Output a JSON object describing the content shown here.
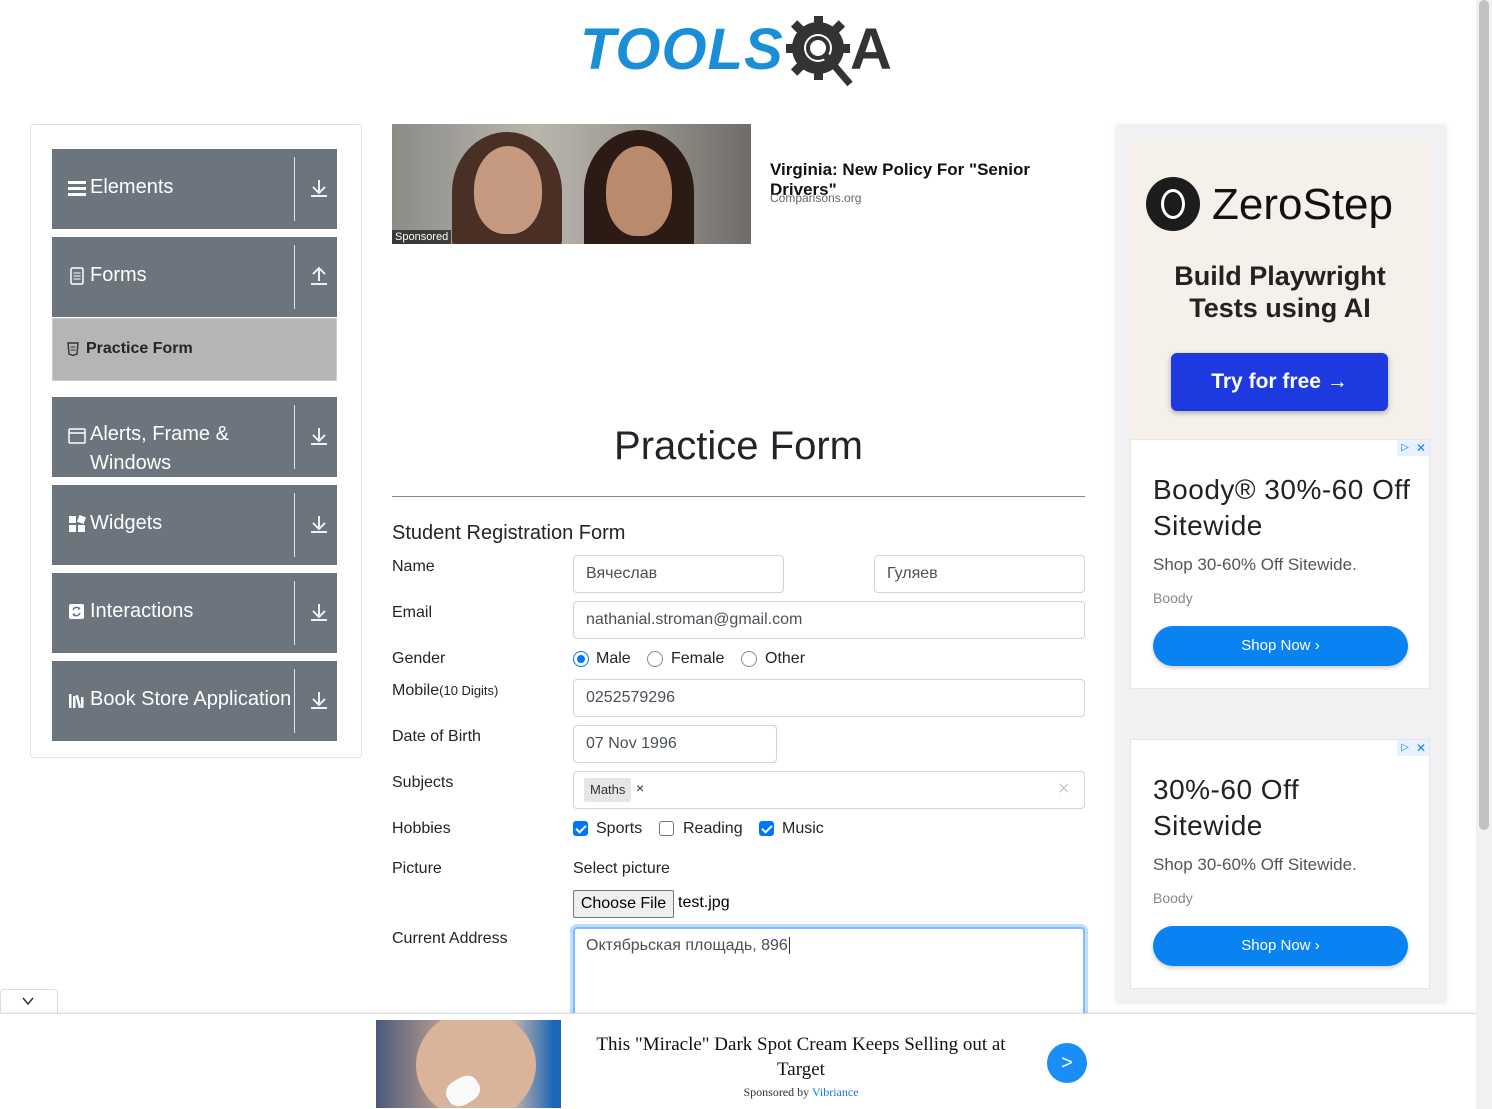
{
  "logo": {
    "text": "TOOLS",
    "suffix": "A"
  },
  "sidebar": {
    "groups": [
      {
        "label": "Elements",
        "icon": "hamburger-icon",
        "expanded": false
      },
      {
        "label": "Forms",
        "icon": "document-icon",
        "expanded": true
      },
      {
        "label": "Alerts, Frame & Windows",
        "icon": "window-icon",
        "expanded": false
      },
      {
        "label": "Widgets",
        "icon": "widgets-icon",
        "expanded": false
      },
      {
        "label": "Interactions",
        "icon": "refresh-icon",
        "expanded": false
      },
      {
        "label": "Book Store Application",
        "icon": "books-icon",
        "expanded": false
      }
    ],
    "forms_items": [
      {
        "label": "Practice Form",
        "active": true
      }
    ]
  },
  "ad_top": {
    "headline": "Virginia: New Policy For \"Senior Drivers\"",
    "source": "Comparisons.org",
    "sponsored": "Sponsored"
  },
  "page": {
    "title": "Practice Form",
    "form_title": "Student Registration Form"
  },
  "form": {
    "name_label": "Name",
    "first_name": "Вячеслав",
    "last_name": "Гуляев",
    "email_label": "Email",
    "email": "nathanial.stroman@gmail.com",
    "gender_label": "Gender",
    "gender_options": [
      "Male",
      "Female",
      "Other"
    ],
    "gender_selected": "Male",
    "mobile_label": "Mobile",
    "mobile_hint": "(10 Digits)",
    "mobile": "0252579296",
    "dob_label": "Date of Birth",
    "dob": "07 Nov 1996",
    "subjects_label": "Subjects",
    "subjects": [
      "Maths"
    ],
    "subject_remove": "×",
    "subjects_clear": "×",
    "hobbies_label": "Hobbies",
    "hobbies": [
      {
        "label": "Sports",
        "checked": true
      },
      {
        "label": "Reading",
        "checked": false
      },
      {
        "label": "Music",
        "checked": true
      }
    ],
    "picture_label": "Picture",
    "picture_prompt": "Select picture",
    "file_button": "Choose File",
    "file_name": "test.jpg",
    "address_label": "Current Address",
    "address": "Октябрьская площадь, 896"
  },
  "ad_zerostep": {
    "brand": "ZeroStep",
    "tagline_1": "Build Playwright",
    "tagline_2": "Tests using AI",
    "button": "Try for free →"
  },
  "ad_boody_1": {
    "headline": "Boody® 30%-60 Off Sitewide",
    "sub": "Shop 30-60% Off Sitewide.",
    "brand": "Boody",
    "button": "Shop Now"
  },
  "ad_boody_2": {
    "headline": "30%-60 Off Sitewide",
    "sub": "Shop 30-60% Off Sitewide.",
    "brand": "Boody",
    "button": "Shop Now"
  },
  "bottom_ad": {
    "title": "This \"Miracle\" Dark Spot Cream Keeps Selling out at Target",
    "sponsored_by": "Sponsored by",
    "sponsor": "Vibriance",
    "button": ">"
  },
  "colors": {
    "sidebar_bg": "#6c757d",
    "active_item_bg": "#b5b5b5",
    "logo_blue": "#1a8fd6",
    "checkbox_blue": "#0075ff",
    "ad_button_blue": "#0a83f2"
  }
}
